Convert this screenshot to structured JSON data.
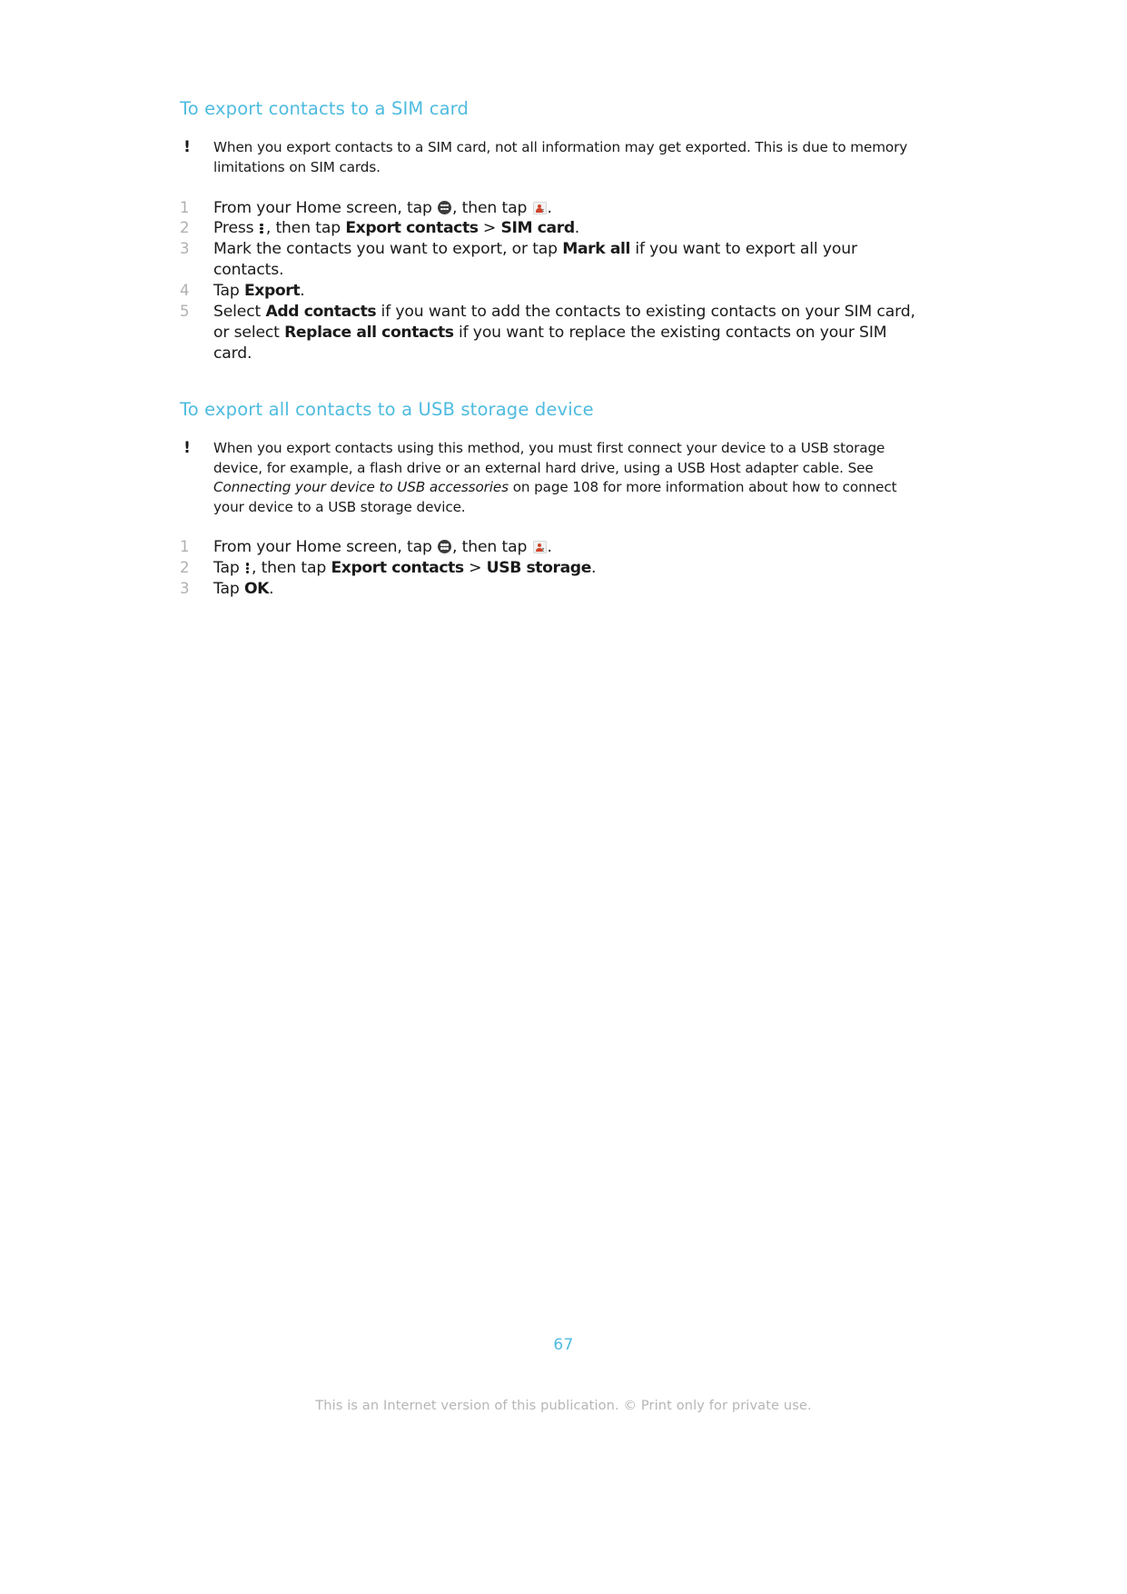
{
  "document": {
    "page_number": "67",
    "footer_note": "This is an Internet version of this publication. © Print only for private use.",
    "accent_color": "#4ebbe0",
    "footer_color": "#b6b6b6"
  },
  "sections": [
    {
      "title": "To export contacts to a SIM card",
      "note": {
        "icon": "exclamation-icon",
        "text": "When you export contacts to a SIM card, not all information may get exported. This is due to memory limitations on SIM cards."
      },
      "steps": [
        {
          "num": "1",
          "parts": [
            {
              "type": "text",
              "value": "From your Home screen, tap "
            },
            {
              "type": "icon",
              "value": "apps-grid-icon"
            },
            {
              "type": "text",
              "value": ", then tap "
            },
            {
              "type": "icon",
              "value": "contacts-icon"
            },
            {
              "type": "text",
              "value": "."
            }
          ]
        },
        {
          "num": "2",
          "parts": [
            {
              "type": "text",
              "value": "Press "
            },
            {
              "type": "icon",
              "value": "overflow-menu-icon"
            },
            {
              "type": "text",
              "value": ", then tap "
            },
            {
              "type": "bold",
              "value": "Export contacts"
            },
            {
              "type": "text",
              "value": " > "
            },
            {
              "type": "bold",
              "value": "SIM card"
            },
            {
              "type": "text",
              "value": "."
            }
          ]
        },
        {
          "num": "3",
          "parts": [
            {
              "type": "text",
              "value": "Mark the contacts you want to export, or tap "
            },
            {
              "type": "bold",
              "value": "Mark all"
            },
            {
              "type": "text",
              "value": " if you want to export all your contacts."
            }
          ]
        },
        {
          "num": "4",
          "parts": [
            {
              "type": "text",
              "value": "Tap "
            },
            {
              "type": "bold",
              "value": "Export"
            },
            {
              "type": "text",
              "value": "."
            }
          ]
        },
        {
          "num": "5",
          "parts": [
            {
              "type": "text",
              "value": "Select "
            },
            {
              "type": "bold",
              "value": "Add contacts"
            },
            {
              "type": "text",
              "value": " if you want to add the contacts to existing contacts on your SIM card, or select "
            },
            {
              "type": "bold",
              "value": "Replace all contacts"
            },
            {
              "type": "text",
              "value": " if you want to replace the existing contacts on your SIM card."
            }
          ]
        }
      ]
    },
    {
      "title": "To export all contacts to a USB storage device",
      "note": {
        "icon": "exclamation-icon",
        "text_before": "When you export contacts using this method, you must first connect your device to a USB storage device, for example, a flash drive or an external hard drive, using a USB Host adapter cable. See ",
        "italic_reference": "Connecting your device to USB accessories",
        "text_after": " on page 108 for more information about how to connect your device to a USB storage device."
      },
      "steps": [
        {
          "num": "1",
          "parts": [
            {
              "type": "text",
              "value": "From your Home screen, tap "
            },
            {
              "type": "icon",
              "value": "apps-grid-icon"
            },
            {
              "type": "text",
              "value": ", then tap "
            },
            {
              "type": "icon",
              "value": "contacts-icon"
            },
            {
              "type": "text",
              "value": "."
            }
          ]
        },
        {
          "num": "2",
          "parts": [
            {
              "type": "text",
              "value": "Tap "
            },
            {
              "type": "icon",
              "value": "overflow-menu-icon"
            },
            {
              "type": "text",
              "value": ", then tap "
            },
            {
              "type": "bold",
              "value": "Export contacts"
            },
            {
              "type": "text",
              "value": " > "
            },
            {
              "type": "bold",
              "value": "USB storage"
            },
            {
              "type": "text",
              "value": "."
            }
          ]
        },
        {
          "num": "3",
          "parts": [
            {
              "type": "text",
              "value": "Tap "
            },
            {
              "type": "bold",
              "value": "OK"
            },
            {
              "type": "text",
              "value": "."
            }
          ]
        }
      ]
    }
  ],
  "note_icon_glyph": "!"
}
